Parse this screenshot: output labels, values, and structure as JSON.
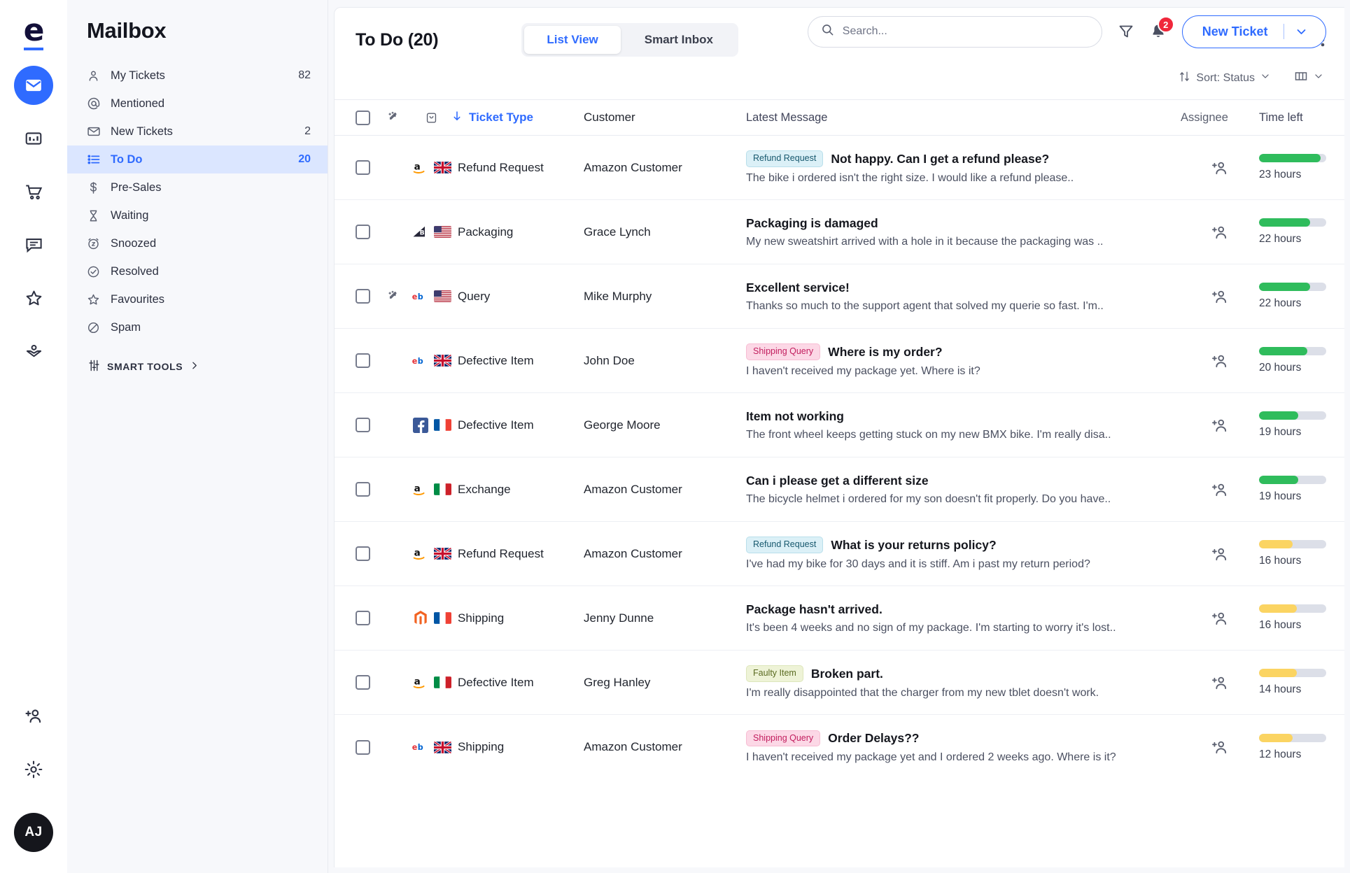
{
  "rail": {
    "logo": "e",
    "items": [
      {
        "name": "mailbox",
        "icon": "envelope-icon",
        "active": true
      },
      {
        "name": "reports",
        "icon": "chart-icon",
        "active": false
      },
      {
        "name": "orders",
        "icon": "cart-icon",
        "active": false
      },
      {
        "name": "chat",
        "icon": "chat-icon",
        "active": false
      },
      {
        "name": "reviews",
        "icon": "star-icon",
        "active": false
      },
      {
        "name": "knowledge",
        "icon": "open-book-icon",
        "active": false
      }
    ],
    "bottom": [
      {
        "name": "invite-user",
        "icon": "add-person-icon"
      },
      {
        "name": "settings",
        "icon": "gear-icon"
      }
    ],
    "avatar_initials": "AJ"
  },
  "sidebar": {
    "title": "Mailbox",
    "items": [
      {
        "label": "My Tickets",
        "count": "82",
        "icon": "person-icon",
        "active": false
      },
      {
        "label": "Mentioned",
        "count": "",
        "icon": "at-icon",
        "active": false
      },
      {
        "label": "New Tickets",
        "count": "2",
        "icon": "envelope-icon",
        "active": false
      },
      {
        "label": "To Do",
        "count": "20",
        "icon": "list-icon",
        "active": true
      },
      {
        "label": "Pre-Sales",
        "count": "",
        "icon": "dollar-icon",
        "active": false
      },
      {
        "label": "Waiting",
        "count": "",
        "icon": "hourglass-icon",
        "active": false
      },
      {
        "label": "Snoozed",
        "count": "",
        "icon": "snooze-icon",
        "active": false
      },
      {
        "label": "Resolved",
        "count": "",
        "icon": "check-circle-icon",
        "active": false
      },
      {
        "label": "Favourites",
        "count": "",
        "icon": "star-icon",
        "active": false
      },
      {
        "label": "Spam",
        "count": "",
        "icon": "block-icon",
        "active": false
      }
    ],
    "smart_tools_label": "SMART TOOLS"
  },
  "topbar": {
    "search_placeholder": "Search...",
    "search_value": "",
    "filter_icon": "filter-icon",
    "notification_icon": "bell-icon",
    "notification_count": "2",
    "new_ticket_label": "New Ticket"
  },
  "main": {
    "title": "To Do (20)",
    "tabs": [
      {
        "label": "List View",
        "active": true
      },
      {
        "label": "Smart Inbox",
        "active": false
      }
    ],
    "info_icon": "info-icon",
    "more_icon": "kebab-menu-icon",
    "sort_label": "Sort: Status",
    "columns_icon": "columns-icon",
    "headers": {
      "ticket_type": "Ticket Type",
      "customer": "Customer",
      "latest_message": "Latest Message",
      "assignee": "Assignee",
      "time_left": "Time left"
    },
    "rows": [
      {
        "source": "amazon",
        "flag": "uk",
        "wand": false,
        "type": "Refund Request",
        "customer": "Amazon Customer",
        "badge": "Refund Request",
        "badge_kind": "refund",
        "title": "Not happy. Can I get a refund please?",
        "preview": "The bike i ordered isn't the right size. I would like a refund please..",
        "time": "23 hours",
        "bar_pct": 92,
        "bar_color": "green"
      },
      {
        "source": "backmarket",
        "flag": "us",
        "wand": false,
        "type": "Packaging",
        "customer": "Grace Lynch",
        "badge": "",
        "badge_kind": "",
        "title": "Packaging is damaged",
        "preview": "My new sweatshirt arrived with a hole in it because the packaging was ..",
        "time": "22 hours",
        "bar_pct": 76,
        "bar_color": "green"
      },
      {
        "source": "ebay",
        "flag": "us",
        "wand": true,
        "type": "Query",
        "customer": "Mike Murphy",
        "badge": "",
        "badge_kind": "",
        "title": "Excellent service!",
        "preview": "Thanks so much to the support agent that solved my querie so fast. I'm..",
        "time": "22 hours",
        "bar_pct": 76,
        "bar_color": "green"
      },
      {
        "source": "ebay",
        "flag": "uk",
        "wand": false,
        "type": "Defective Item",
        "customer": "John Doe",
        "badge": "Shipping Query",
        "badge_kind": "shipping",
        "title": "Where is my order?",
        "preview": "I haven't received my package yet. Where is it?",
        "time": "20 hours",
        "bar_pct": 72,
        "bar_color": "green"
      },
      {
        "source": "facebook",
        "flag": "fr",
        "wand": false,
        "type": "Defective Item",
        "customer": "George Moore",
        "badge": "",
        "badge_kind": "",
        "title": "Item not working",
        "preview": "The front wheel keeps getting stuck on my new BMX bike. I'm really disa..",
        "time": "19 hours",
        "bar_pct": 58,
        "bar_color": "green"
      },
      {
        "source": "amazon",
        "flag": "it",
        "wand": false,
        "type": "Exchange",
        "customer": "Amazon Customer",
        "badge": "",
        "badge_kind": "",
        "title": "Can i please get a different size",
        "preview": "The bicycle helmet i ordered for my son doesn't fit properly. Do you have..",
        "time": "19 hours",
        "bar_pct": 58,
        "bar_color": "green"
      },
      {
        "source": "amazon",
        "flag": "uk",
        "wand": false,
        "type": "Refund Request",
        "customer": "Amazon Customer",
        "badge": "Refund Request",
        "badge_kind": "refund",
        "title": "What is your returns policy?",
        "preview": "I've had my bike for 30 days and it is stiff. Am i past my return period?",
        "time": "16 hours",
        "bar_pct": 50,
        "bar_color": "yellow"
      },
      {
        "source": "magento",
        "flag": "fr",
        "wand": false,
        "type": "Shipping",
        "customer": "Jenny Dunne",
        "badge": "",
        "badge_kind": "",
        "title": "Package hasn't arrived.",
        "preview": "It's been 4 weeks and no sign of my package. I'm starting to worry it's lost..",
        "time": "16 hours",
        "bar_pct": 56,
        "bar_color": "yellow"
      },
      {
        "source": "amazon",
        "flag": "it",
        "wand": false,
        "type": "Defective Item",
        "customer": "Greg Hanley",
        "badge": "Faulty Item",
        "badge_kind": "faulty",
        "title": "Broken part.",
        "preview": "I'm really disappointed that the charger from my new tblet doesn't  work.",
        "time": "14 hours",
        "bar_pct": 56,
        "bar_color": "yellow"
      },
      {
        "source": "ebay",
        "flag": "uk",
        "wand": false,
        "type": "Shipping",
        "customer": "Amazon Customer",
        "badge": "Shipping Query",
        "badge_kind": "shipping",
        "title": "Order Delays??",
        "preview": "I haven't received my package yet and I ordered 2 weeks ago. Where is it?",
        "time": "12 hours",
        "bar_pct": 50,
        "bar_color": "yellow"
      }
    ]
  },
  "colors": {
    "accent": "#2f6bff",
    "green": "#2fbc5c",
    "yellow": "#fbd462",
    "alert": "#f0273b"
  }
}
